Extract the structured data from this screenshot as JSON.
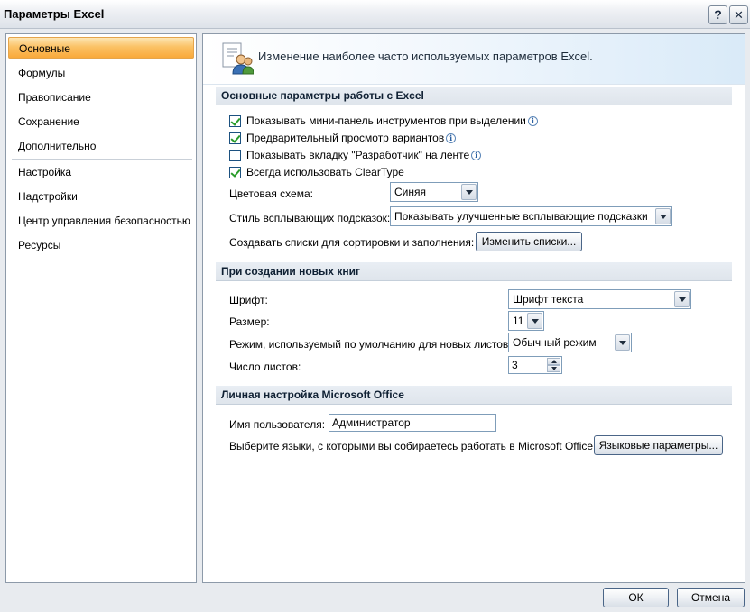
{
  "window": {
    "title": "Параметры Excel",
    "help_label": "?",
    "close_label": "✕"
  },
  "sidebar": {
    "items": [
      {
        "label": "Основные",
        "active": true
      },
      {
        "label": "Формулы"
      },
      {
        "label": "Правописание"
      },
      {
        "label": "Сохранение"
      },
      {
        "label": "Дополнительно"
      },
      {
        "label": "Настройка"
      },
      {
        "label": "Надстройки"
      },
      {
        "label": "Центр управления безопасностью"
      },
      {
        "label": "Ресурсы"
      }
    ]
  },
  "banner": {
    "text": "Изменение наиболее часто используемых параметров Excel."
  },
  "section_basic": {
    "title": "Основные параметры работы с Excel",
    "checkboxes": [
      {
        "label": "Показывать мини-панель инструментов при выделении",
        "checked": true,
        "info": true
      },
      {
        "label": "Предварительный просмотр вариантов",
        "checked": true,
        "info": true
      },
      {
        "label": "Показывать вкладку \"Разработчик\" на ленте",
        "checked": false,
        "info": true
      },
      {
        "label": "Всегда использовать ClearType",
        "checked": true,
        "info": false
      }
    ],
    "color_scheme_label": "Цветовая схема:",
    "color_scheme_value": "Синяя",
    "tooltip_style_label": "Стиль всплывающих подсказок:",
    "tooltip_style_value": "Показывать улучшенные всплывающие подсказки",
    "lists_label": "Создавать списки для сортировки и заполнения:",
    "lists_button": "Изменить списки..."
  },
  "section_new": {
    "title": "При создании новых книг",
    "font_label": "Шрифт:",
    "font_value": "Шрифт текста",
    "size_label": "Размер:",
    "size_value": "11",
    "mode_label": "Режим, используемый по умолчанию для новых листов:",
    "mode_value": "Обычный режим",
    "sheets_label": "Число листов:",
    "sheets_value": "3"
  },
  "section_personal": {
    "title": "Личная настройка Microsoft Office",
    "username_label": "Имя пользователя:",
    "username_value": "Администратор",
    "languages_label": "Выберите языки, с которыми вы собираетесь работать в Microsoft Office:",
    "languages_button": "Языковые параметры..."
  },
  "footer": {
    "ok_label": "ОК",
    "cancel_label": "Отмена"
  },
  "icons": {
    "info": "info-icon",
    "banner": "options-people-icon"
  }
}
